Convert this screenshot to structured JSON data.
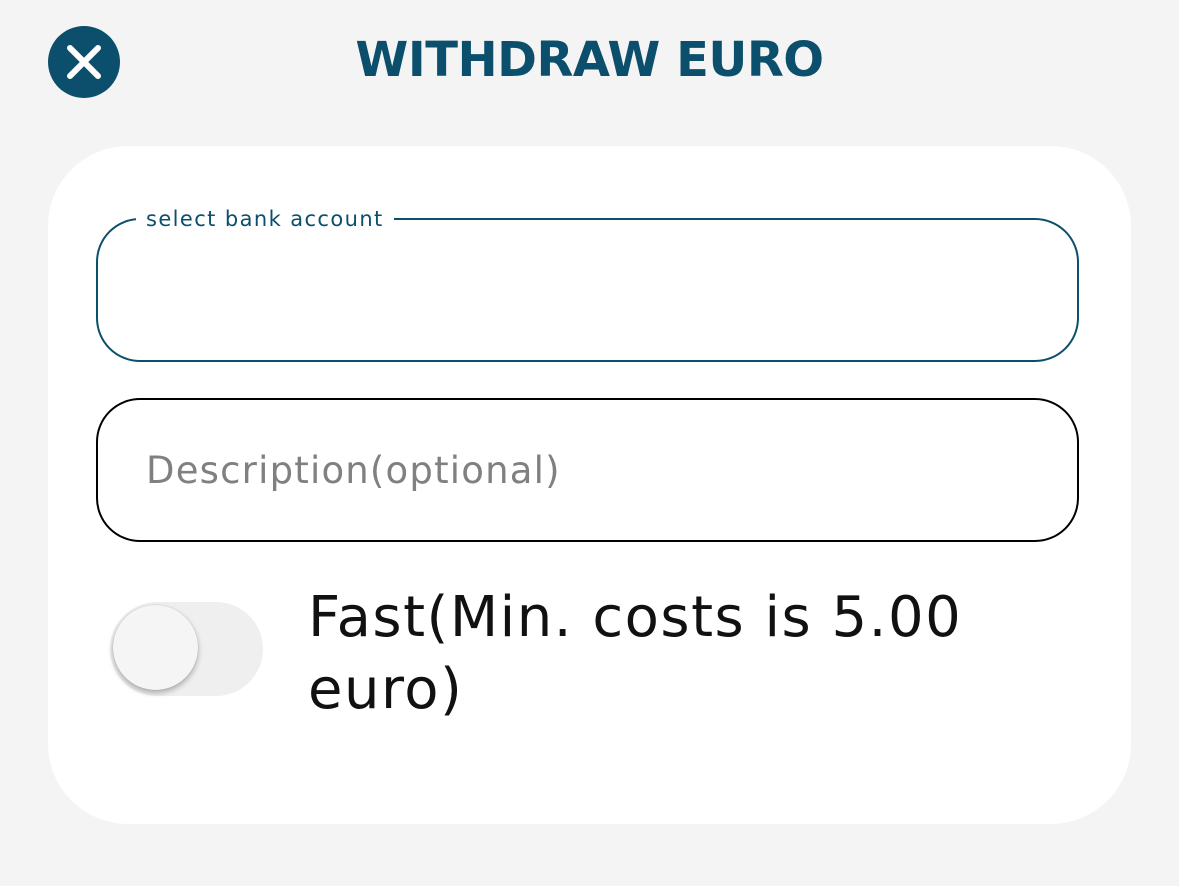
{
  "header": {
    "title": "WITHDRAW EURO",
    "close_icon": "close-icon"
  },
  "form": {
    "bank_account": {
      "label": "select bank account",
      "value": ""
    },
    "description": {
      "placeholder": "Description(optional)",
      "value": ""
    },
    "fast_toggle": {
      "label": "Fast(Min. costs is 5.00 euro)",
      "checked": false
    }
  },
  "colors": {
    "accent": "#0b4f6c",
    "background": "#f4f4f4",
    "card": "#ffffff"
  }
}
